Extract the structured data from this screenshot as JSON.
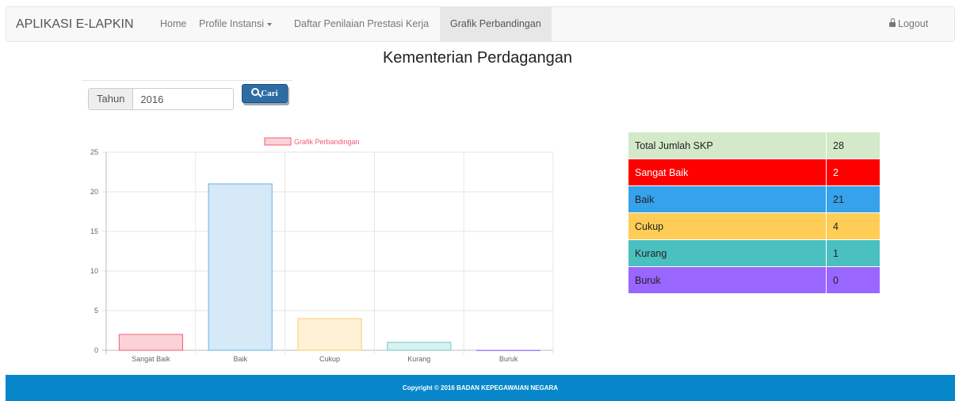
{
  "navbar": {
    "brand": "APLIKASI E-LAPKIN",
    "items": [
      {
        "label": "Home"
      },
      {
        "label": "Profile Instansi"
      },
      {
        "label": "Daftar Penilaian Prestasi Kerja"
      },
      {
        "label": "Grafik Perbandingan"
      }
    ],
    "logout": "Logout"
  },
  "page_title": "Kementerian Perdagangan",
  "search": {
    "addon_label": "Tahun",
    "value": "2016",
    "button_label": "Cari"
  },
  "chart_data": {
    "type": "bar",
    "categories": [
      "Sangat Baik",
      "Baik",
      "Cukup",
      "Kurang",
      "Buruk"
    ],
    "series": [
      {
        "name": "Grafik Perbandingan",
        "values": [
          2,
          21,
          4,
          1,
          0
        ]
      }
    ],
    "ylim": [
      0,
      25
    ],
    "yticks": [
      0,
      5,
      10,
      15,
      20,
      25
    ],
    "legend": "top-center",
    "grid": true,
    "colors": {
      "fills": [
        "#fbd2d7",
        "#d5e9f7",
        "#fef1d6",
        "#d9f1f1",
        "#e9dcff"
      ],
      "borders": [
        "#f05d77",
        "#62b2e8",
        "#fccf6f",
        "#6ccbcb",
        "#a780ff"
      ],
      "legend_fill": "#fbd2d7",
      "legend_border": "#f05d77",
      "legend_text": "#f0587a"
    }
  },
  "summary": {
    "rows": [
      {
        "label": "Total Jumlah SKP",
        "value": "28",
        "bg": "#d4e8ca",
        "fg": "#222222"
      },
      {
        "label": "Sangat Baik",
        "value": "2",
        "bg": "#fe0000",
        "fg": "#ffffff"
      },
      {
        "label": "Baik",
        "value": "21",
        "bg": "#36a2eb",
        "fg": "#222222"
      },
      {
        "label": "Cukup",
        "value": "4",
        "bg": "#ffcd56",
        "fg": "#222222"
      },
      {
        "label": "Kurang",
        "value": "1",
        "bg": "#4bc0c0",
        "fg": "#222222"
      },
      {
        "label": "Buruk",
        "value": "0",
        "bg": "#9966ff",
        "fg": "#222222"
      }
    ]
  },
  "footer": {
    "text": "Copyright © 2016 BADAN KEPEGAWAIAN NEGARA"
  }
}
